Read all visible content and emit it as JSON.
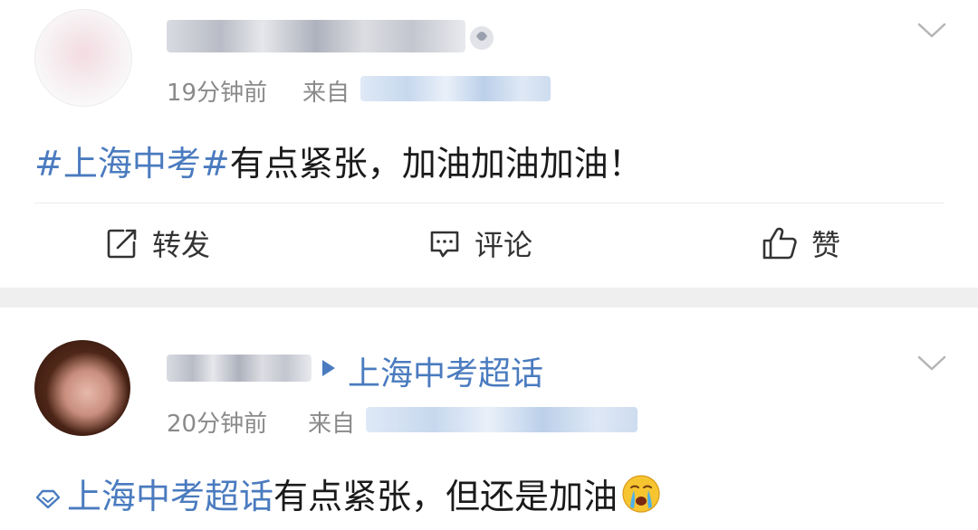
{
  "posts": [
    {
      "time": "19分钟前",
      "source_prefix": "来自",
      "content": {
        "topic": "#上海中考#",
        "text": "有点紧张，加油加油加油！"
      },
      "actions": {
        "repost_label": "转发",
        "comment_label": "评论",
        "like_label": "赞"
      }
    },
    {
      "supertopic": "上海中考超话",
      "time": "20分钟前",
      "source_prefix": "来自",
      "content": {
        "supertopic_tag": "上海中考超话",
        "text": "有点紧张，但还是加油",
        "emoji": "crying-face"
      }
    }
  ],
  "colors": {
    "link": "#4a7bbf",
    "meta": "#8a8a8a",
    "separator": "#efefef"
  }
}
